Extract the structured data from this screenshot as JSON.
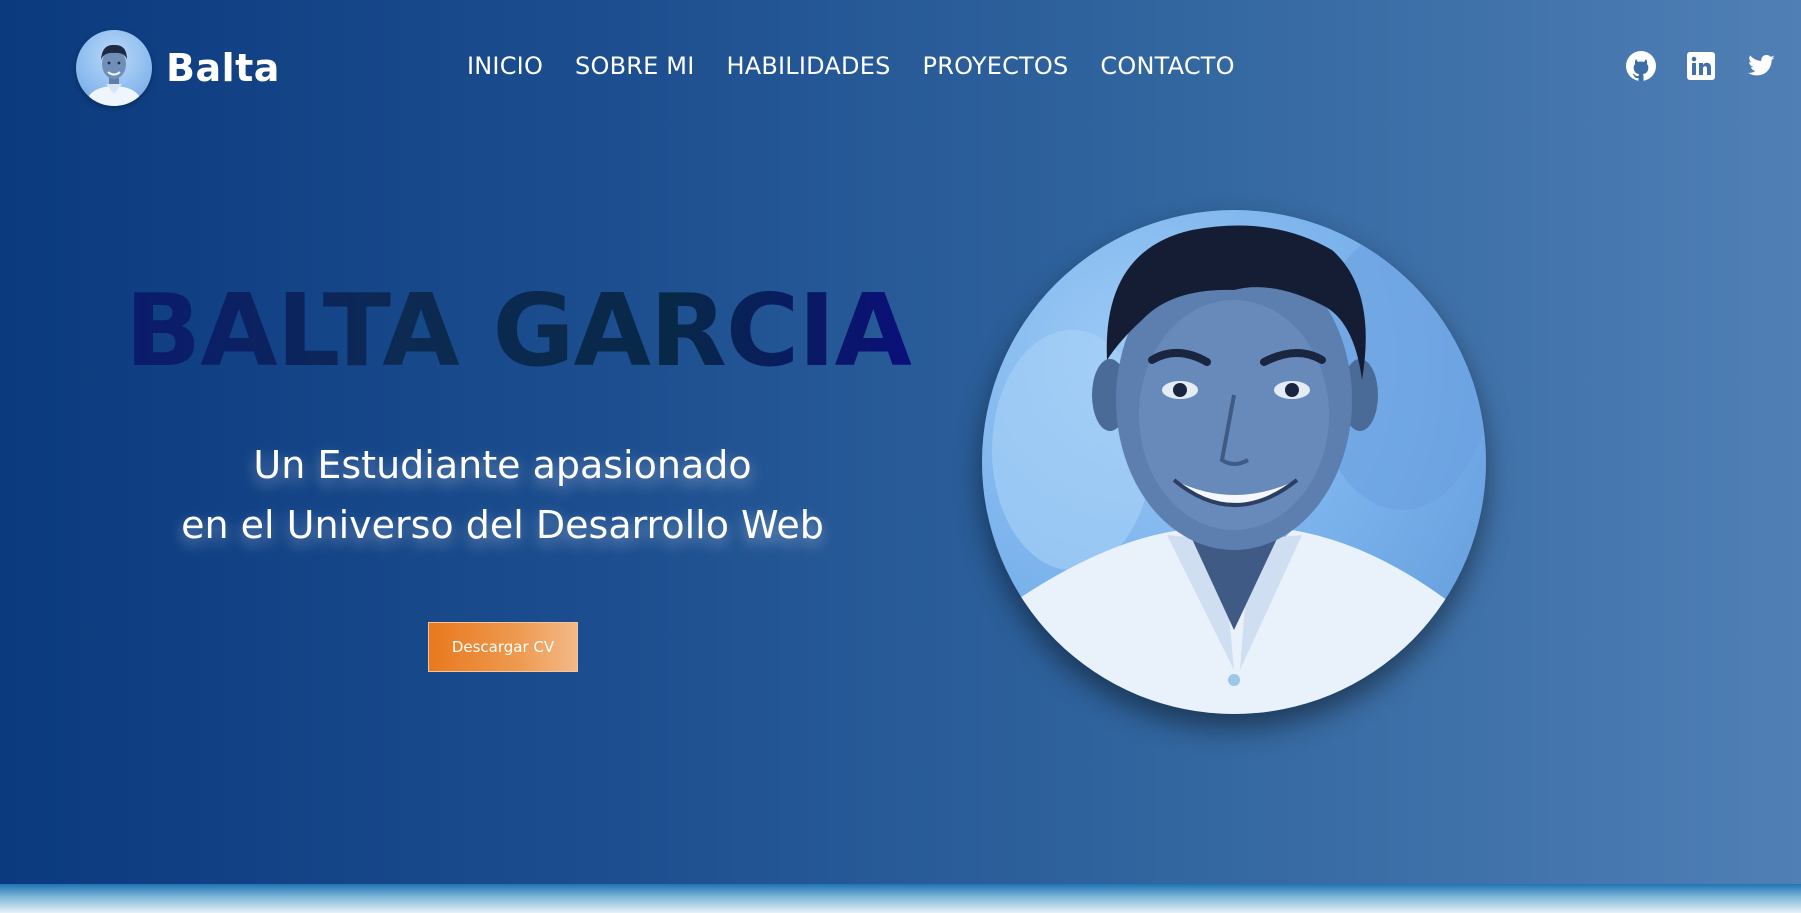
{
  "brand": {
    "name": "Balta",
    "avatar_icon": "profile-photo-icon"
  },
  "nav": {
    "items": [
      {
        "label": "INICIO"
      },
      {
        "label": "SOBRE MI"
      },
      {
        "label": "HABILIDADES"
      },
      {
        "label": "PROYECTOS"
      },
      {
        "label": "CONTACTO"
      }
    ]
  },
  "social": [
    {
      "icon": "github-icon"
    },
    {
      "icon": "linkedin-icon"
    },
    {
      "icon": "twitter-icon"
    }
  ],
  "hero": {
    "title": "BALTA GARCIA",
    "subtitle_line1": "Un Estudiante apasionado",
    "subtitle_line2": "en el Universo del Desarrollo Web",
    "cta_label": "Descargar CV"
  },
  "colors": {
    "gradient_start": "#0b3a7e",
    "gradient_end": "#4f7fb5",
    "cta_orange": "#e8791e",
    "title_dark": "#0b1a6e"
  }
}
